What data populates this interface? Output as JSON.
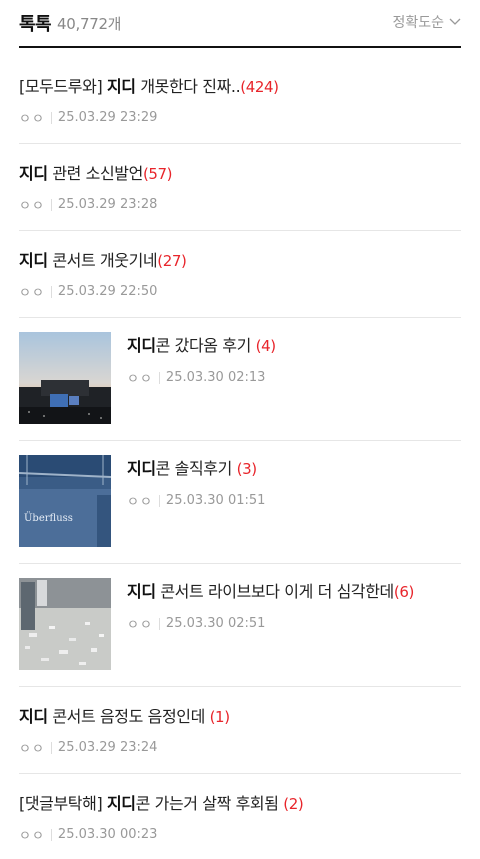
{
  "header": {
    "title": "톡톡",
    "count": "40,772개",
    "sort_label": "정확도순"
  },
  "posts": [
    {
      "prefix": "[모두드루와]",
      "keyword": "지디",
      "rest": "개못한다 진짜..",
      "comments": "(424)",
      "author": "ㅇㅇ",
      "date": "25.03.29 23:29"
    },
    {
      "prefix": "",
      "keyword": "지디",
      "rest": "관련 소신발언",
      "comments": "(57)",
      "author": "ㅇㅇ",
      "date": "25.03.29 23:28"
    },
    {
      "prefix": "",
      "keyword": "지디",
      "rest": "콘서트 개웃기네",
      "comments": "(27)",
      "author": "ㅇㅇ",
      "date": "25.03.29 22:50"
    },
    {
      "prefix": "",
      "keyword": "지디",
      "rest": "콘 갔다옴 후기",
      "comments": "(4)",
      "author": "ㅇㅇ",
      "date": "25.03.30 02:13"
    },
    {
      "prefix": "",
      "keyword": "지디",
      "rest": "콘 솔직후기",
      "comments": "(3)",
      "author": "ㅇㅇ",
      "date": "25.03.30 01:51"
    },
    {
      "prefix": "",
      "keyword": "지디",
      "rest": "콘서트 라이브보다 이게 더 심각한데",
      "comments": "(6)",
      "author": "ㅇㅇ",
      "date": "25.03.30 02:51"
    },
    {
      "prefix": "",
      "keyword": "지디",
      "rest": "콘서트 음정도 음정인데",
      "comments": "(1)",
      "author": "ㅇㅇ",
      "date": "25.03.29 23:24"
    },
    {
      "prefix": "[댓글부탁해]",
      "keyword": "지디",
      "rest": "콘 가는거 살짝 후회됨",
      "comments": "(2)",
      "author": "ㅇㅇ",
      "date": "25.03.30 00:23"
    }
  ],
  "thumbnails": {
    "post_4": "Überfluss",
    "icon_chevron": "chevron-down-icon"
  },
  "colors": {
    "keyword": "#111111",
    "comment_count": "#e8252b",
    "meta": "#999999",
    "divider": "#e6e6e6"
  }
}
